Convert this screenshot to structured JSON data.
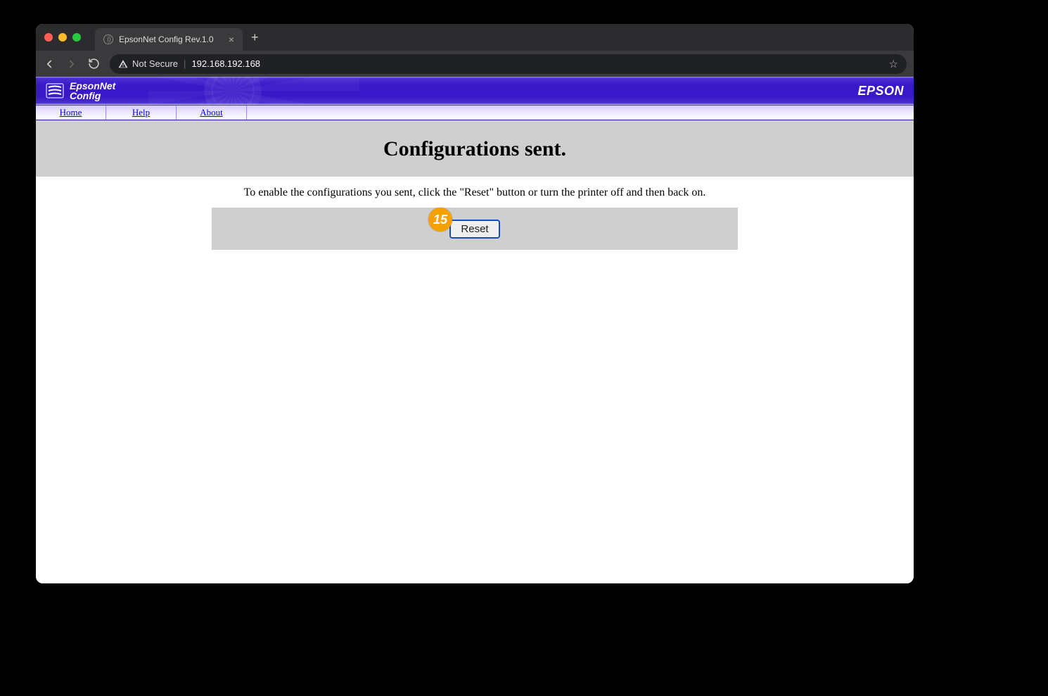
{
  "browser": {
    "tab_title": "EpsonNet Config Rev.1.0",
    "not_secure_label": "Not Secure",
    "url": "192.168.192.168"
  },
  "banner": {
    "logo_line1": "EpsonNet",
    "logo_line2": "Config",
    "brand": "EPSON"
  },
  "menu": {
    "home": "Home",
    "help": "Help",
    "about": "About"
  },
  "page": {
    "heading": "Configurations sent.",
    "instruction": "To enable the configurations you sent, click the \"Reset\" button or turn the printer off and then back on.",
    "reset_label": "Reset"
  },
  "annotation": {
    "badge": "15"
  }
}
